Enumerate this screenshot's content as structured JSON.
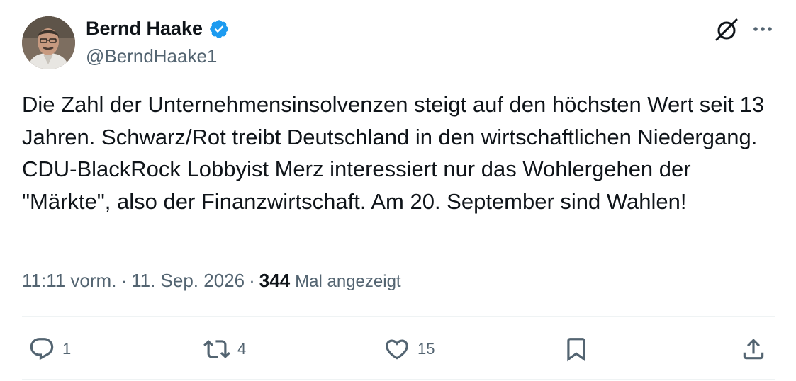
{
  "author": {
    "display_name": "Bernd Haake",
    "handle": "@BerndHaake1",
    "verified": true
  },
  "tweet": {
    "text": "Die Zahl der Unternehmensinsolvenzen steigt auf den höchsten Wert seit 13 Jahren. Schwarz/Rot treibt Deutschland in den wirtschaftlichen Niedergang. CDU-BlackRock Lobbyist Merz interessiert nur das Wohlergehen der \"Märkte\", also der Finanzwirtschaft. Am 20. September sind Wahlen!",
    "time": "11:11 vorm.",
    "separator": "·",
    "date": "11. Sep. 2026",
    "views_count": "344",
    "views_label": "Mal angezeigt"
  },
  "actions": {
    "replies": "1",
    "retweets": "4",
    "likes": "15"
  },
  "icons": {
    "verified": "verified-badge-icon",
    "grok": "grok-icon",
    "more": "more-horizontal-icon",
    "reply": "reply-icon",
    "retweet": "retweet-icon",
    "like": "heart-icon",
    "bookmark": "bookmark-icon",
    "share": "share-icon"
  },
  "colors": {
    "text_primary": "#0f1419",
    "text_secondary": "#536471",
    "verified_blue": "#1d9bf0",
    "divider": "#eff3f4"
  }
}
